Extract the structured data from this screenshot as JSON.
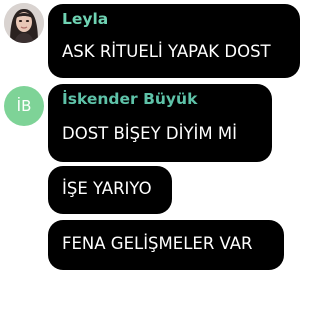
{
  "messages": [
    {
      "sender": "Leyla",
      "sender_color": "#6fd3b3",
      "avatar": "photo",
      "lines": [
        "ASK RİTUELİ YAPAK DOST"
      ]
    },
    {
      "sender": "İskender Büyük",
      "sender_color": "#5ec2a8",
      "avatar": "initials",
      "avatar_text": "İB",
      "avatar_color": "#7ed397",
      "lines": [
        "DOST BİŞEY DİYİM Mİ",
        "İŞE YARIYO",
        "FENA GELİŞMELER VAR"
      ]
    }
  ]
}
